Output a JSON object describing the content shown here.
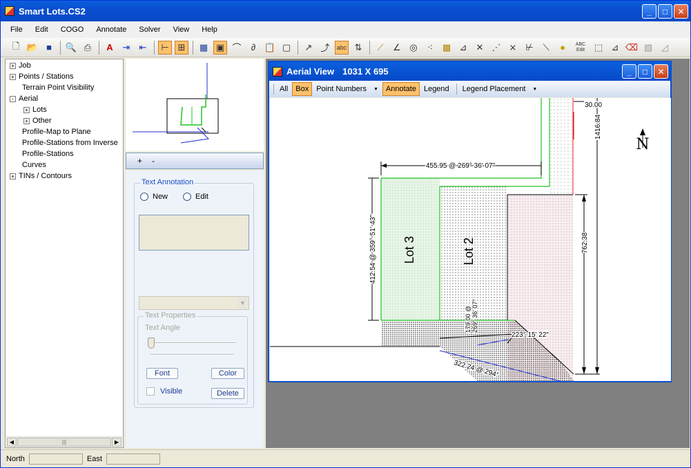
{
  "window": {
    "title": "Smart Lots.CS2"
  },
  "window_controls": {
    "minimize": "_",
    "maximize": "□",
    "close": "✕"
  },
  "menu": [
    "File",
    "Edit",
    "COGO",
    "Annotate",
    "Solver",
    "View",
    "Help"
  ],
  "toolbar": {
    "tools": [
      "new-file",
      "open-folder",
      "save",
      "print-preview",
      "print",
      "text-style",
      "arrow-right",
      "arrow-left",
      "tree-view",
      "extents",
      "table",
      "window-select",
      "curve",
      "spiral",
      "paste",
      "frame",
      "line",
      "curve-line",
      "abc",
      "north-arrow"
    ],
    "abc_label": "abc",
    "abc_edit_label": "ABC Edit"
  },
  "tree": {
    "items": [
      {
        "label": "Job",
        "expander": "+"
      },
      {
        "label": "Points / Stations",
        "expander": "+"
      },
      {
        "label": "Terrain Point Visibility",
        "expander": ""
      },
      {
        "label": "Aerial",
        "expander": "-"
      },
      {
        "label": "Lots",
        "expander": "+"
      },
      {
        "label": "Other",
        "expander": "+"
      },
      {
        "label": "Profile-Map to Plane",
        "expander": ""
      },
      {
        "label": "Profile-Stations from Inverse",
        "expander": ""
      },
      {
        "label": "Profile-Stations",
        "expander": ""
      },
      {
        "label": "Curves",
        "expander": ""
      },
      {
        "label": "TINs / Contours",
        "expander": "+"
      }
    ]
  },
  "panel": {
    "plus": "+",
    "minus": "-",
    "text_annotation": {
      "group_label": "Text Annotation",
      "new_label": "New",
      "edit_label": "Edit"
    },
    "text_properties": {
      "group_label": "Text Properties",
      "angle_label": "Text Angle",
      "font_button": "Font",
      "color_button": "Color",
      "visible_label": "Visible",
      "delete_button": "Delete"
    }
  },
  "aerial_view": {
    "title": "Aerial View",
    "dimensions": "1031  X  695",
    "toolbar": {
      "all": "All",
      "box": "Box",
      "point_numbers": "Point Numbers",
      "annotate": "Annotate",
      "legend": "Legend",
      "legend_placement": "Legend Placement"
    },
    "drawing": {
      "north": "N",
      "lot3": "Lot 3",
      "lot2": "Lot 2",
      "dim_top": "455.95 @  269° 36' 07\"",
      "dim_left": "412.54 @  359° 51' 43\"",
      "dim_right1": "762.38",
      "dim_right2": "1416.84",
      "dim_small": "30.00",
      "dim_bottom": "322.24 @  294°",
      "dim_mid": "223° 15' 22\"",
      "dim_lot2_a": "179.00 @",
      "dim_lot2_b": "269° 36' 07\""
    },
    "colors": {
      "green": "#22c422",
      "blue": "#1f2fd0",
      "red": "#e02020"
    }
  },
  "status": {
    "north_label": "North",
    "east_label": "East"
  }
}
